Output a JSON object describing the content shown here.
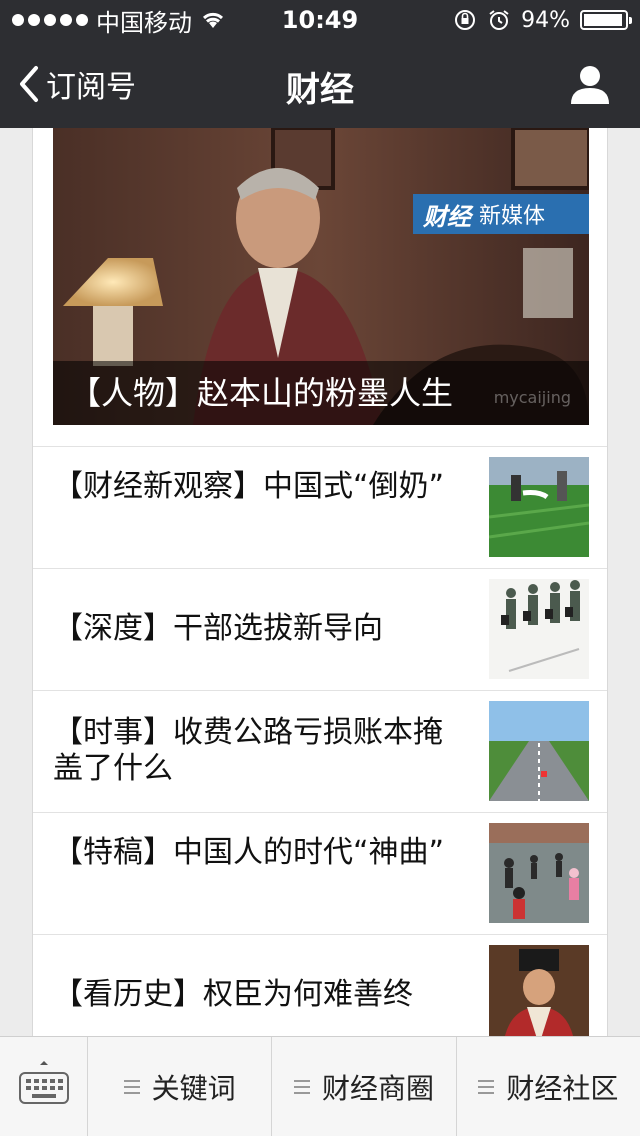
{
  "status_bar": {
    "carrier": "中国移动",
    "time": "10:49",
    "battery": "94%",
    "battery_level": 0.94
  },
  "nav": {
    "back_label": "订阅号",
    "title": "财经"
  },
  "hero": {
    "caption": "【人物】赵本山的粉墨人生",
    "watermark": "mycaijing",
    "badge_logo": "财经",
    "badge_text": "新媒体"
  },
  "articles": [
    {
      "title": "【财经新观察】中国式“倒奶”",
      "thumb_icon": "farm-photo"
    },
    {
      "title": "【深度】干部选拔新导向",
      "thumb_icon": "officials-figures-photo"
    },
    {
      "title": "【时事】收费公路亏损账本掩盖了什么",
      "thumb_icon": "highway-photo"
    },
    {
      "title": "【特稿】中国人的时代“神曲”",
      "thumb_icon": "square-dance-photo"
    },
    {
      "title": "【看历史】权臣为何难善终",
      "thumb_icon": "historical-official-photo"
    }
  ],
  "menu": {
    "items": [
      "关键词",
      "财经商圈",
      "财经社区"
    ]
  },
  "colors": {
    "header_bg": "#2d2e32",
    "card_bg": "#ffffff",
    "page_bg": "#ececec",
    "menu_bg": "#f6f6f6"
  }
}
